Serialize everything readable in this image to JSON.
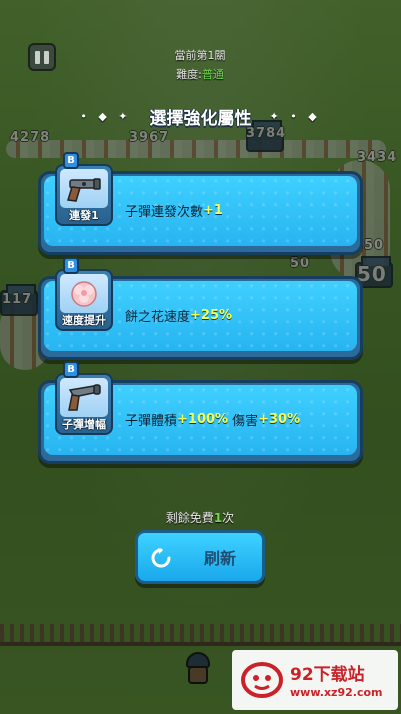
{
  "hud": {
    "stage_label": "當前第1關",
    "difficulty_label": "難度:",
    "difficulty_value": "普通"
  },
  "background": {
    "wall_numbers": [
      "4278",
      "3967",
      "3784",
      "3434",
      "50",
      "50",
      "50",
      "117"
    ]
  },
  "modal": {
    "title": "選擇強化屬性",
    "deco_left": "• ◆ ✦",
    "deco_right": "✦ • ◆",
    "cards": [
      {
        "rank": "B",
        "icon": "gun-icon",
        "caption": "連發1",
        "description": "子彈連發次數",
        "bonuses": [
          "+1"
        ],
        "between": []
      },
      {
        "rank": "B",
        "icon": "flower-icon",
        "caption": "速度提升",
        "description": "餅之花速度",
        "bonuses": [
          "+25%"
        ],
        "between": []
      },
      {
        "rank": "B",
        "icon": "cannon-icon",
        "caption": "子彈增幅",
        "description": "子彈體積",
        "bonuses": [
          "+100%",
          "+30%"
        ],
        "between": [
          "傷害"
        ]
      }
    ],
    "free_prefix": "剩餘免費",
    "free_count": "1",
    "free_suffix": "次",
    "refresh_label": "刷新"
  },
  "watermark": {
    "title": "92下载站",
    "url": "www.xz92.com"
  },
  "colors": {
    "card_fill": "#27b4f1",
    "bonus": "#f7ff4d",
    "difficulty": "#6fdc4c"
  }
}
